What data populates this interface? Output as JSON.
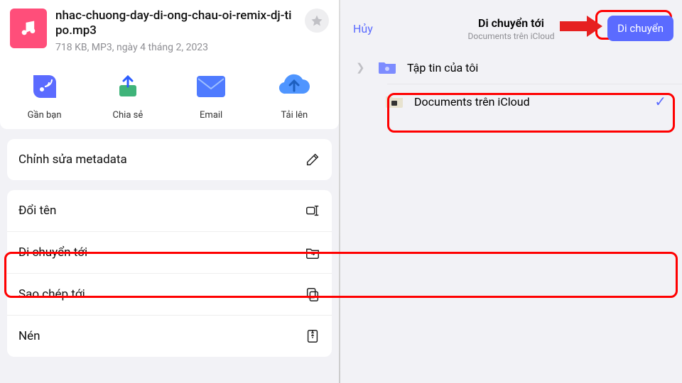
{
  "file": {
    "name": "nhac-chuong-day-di-ong-chau-oi-remix-dj-tipo.mp3",
    "meta": "718 KB, MP3, ngày 4 tháng 2, 2023"
  },
  "share": {
    "nearby": "Gần bạn",
    "share": "Chia sẻ",
    "email": "Email",
    "upload": "Tải lên"
  },
  "actions": {
    "edit_metadata": "Chỉnh sửa metadata",
    "rename": "Đổi tên",
    "move_to": "Di chuyển tới",
    "copy_to": "Sao chép tới",
    "compress": "Nén"
  },
  "right": {
    "cancel": "Hủy",
    "title": "Di chuyển tới",
    "subtitle": "Documents trên iCloud",
    "move_btn": "Di chuyển",
    "my_files": "Tập tin của tôi",
    "docs_icloud": "Documents trên iCloud"
  }
}
